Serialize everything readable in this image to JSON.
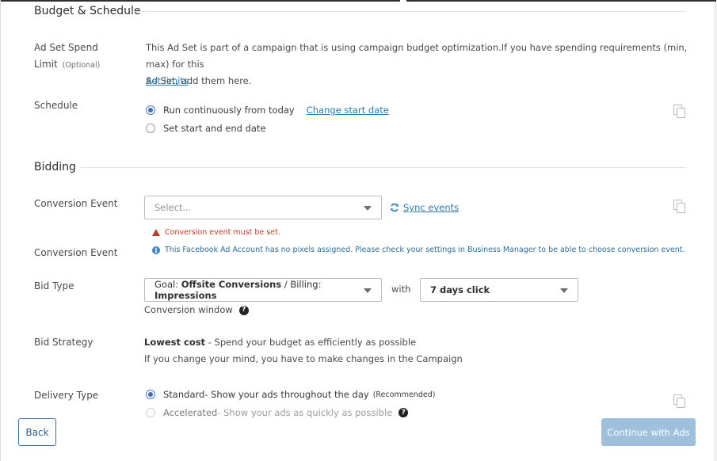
{
  "budget_section": {
    "title": "Budget & Schedule",
    "spending_limit_label": "Ad Set Spend",
    "spending_limit_label2": "Limit",
    "optional": "(Optional)",
    "spending_limit_text1": "This Ad Set is part of a campaign that is using campaign budget optimization.If you have spending requirements (min, max) for this",
    "spending_limit_text2": "Ad Set, add them here.",
    "set_limits": "Set limits"
  },
  "schedule": {
    "label": "Schedule",
    "option_continuous": "Run continuously from today",
    "change_start": "Change start date",
    "option_start_end": "Set start and end date",
    "selected": "continuous"
  },
  "bidding_section": {
    "title": "Bidding",
    "conversion_event_label": "Conversion Event",
    "conversion_event_placeholder": "Select...",
    "sync_events": "Sync events",
    "error_text": "Conversion event must be set.",
    "conversion_event_label2": "Conversion Event",
    "info_text": "This Facebook Ad Account has no pixels assigned. Please check your settings in Business Manager to be able to choose conversion event."
  },
  "bid_type": {
    "label": "Bid Type",
    "goal_prefix": "Goal: ",
    "goal_value": "Offsite Conversions",
    "billing_prefix": " / Billing: ",
    "billing_value": "Impressions",
    "with": "with",
    "window_value": "7 days click",
    "conversion_window": "Conversion window"
  },
  "bid_strategy": {
    "label": "Bid Strategy",
    "value": "Lowest cost",
    "description": " -  Spend your budget as efficiently as possible",
    "note": "If you change your mind, you have to make changes in the Campaign"
  },
  "delivery": {
    "label": "Delivery Type",
    "standard": "Standard",
    "standard_desc": " - Show your ads throughout the day",
    "recommended": "(Recommended)",
    "accelerated": "Accelerated",
    "accelerated_desc": " - Show your ads as quickly as possible",
    "selected": "standard"
  },
  "footer": {
    "back": "Back",
    "continue": "Continue with Ads"
  },
  "colors": {
    "accent": "#3e6eb3",
    "link": "#2a7ab0",
    "error": "#c0392b",
    "continue_disabled": "#9fc0dd"
  },
  "icons": {
    "copy": "copy-icon",
    "sync": "sync-icon",
    "warning": "warning-icon",
    "info": "info-icon",
    "help": "question-icon"
  }
}
